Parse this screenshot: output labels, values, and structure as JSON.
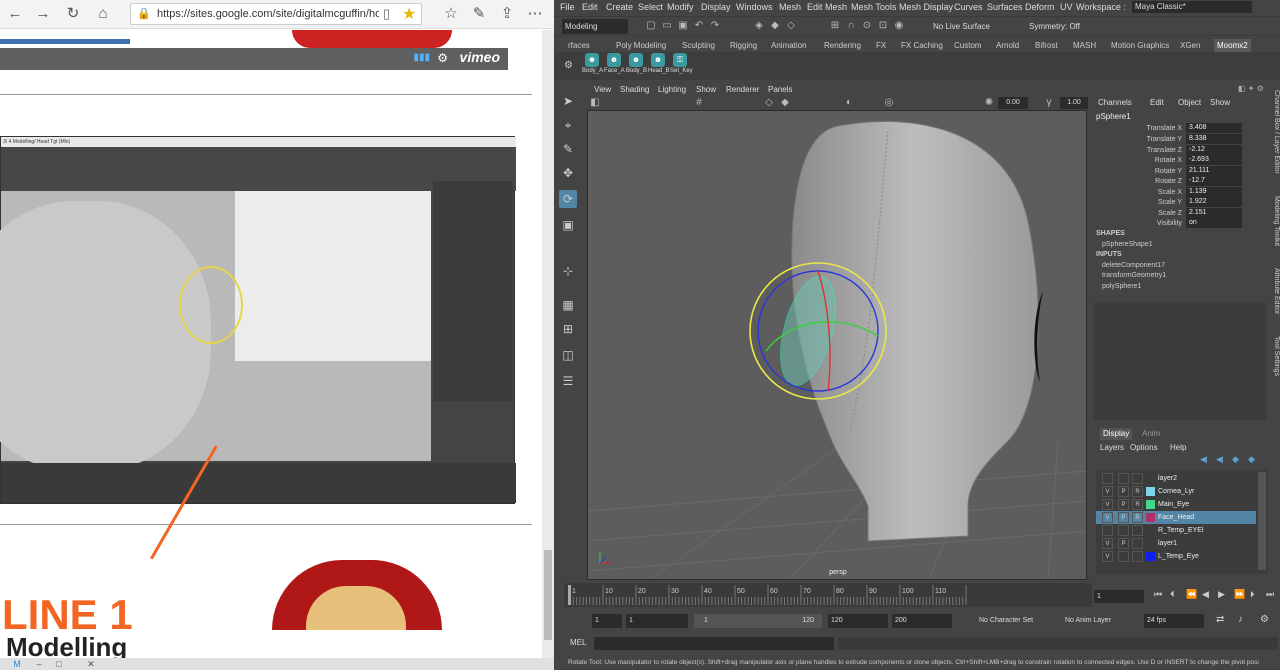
{
  "browser": {
    "url": "https://sites.google.com/site/digitalmcguffin/home/pipeli",
    "vimeo": "vimeo",
    "embed_title": "3/ 4 Modelling/ Head Tgt (Mlo)",
    "line1": "LINE 1",
    "modelling": "Modelling"
  },
  "maya": {
    "menus": [
      "File",
      "Edit",
      "Create",
      "Select",
      "Modify",
      "Display",
      "Windows",
      "Mesh",
      "Edit Mesh",
      "Mesh Tools",
      "Mesh Display",
      "Curves",
      "Surfaces",
      "Deform",
      "UV"
    ],
    "workspace_label": "Workspace :",
    "workspace_value": "Maya Classic*",
    "mode": "Modeling",
    "live_surface": "No Live Surface",
    "symmetry": "Symmetry: Off",
    "shelf_tabs": [
      "rfaces",
      "Poly Modeling",
      "Sculpting",
      "Rigging",
      "Animation",
      "Rendering",
      "FX",
      "FX Caching",
      "Custom",
      "Arnold",
      "Bifrost",
      "MASH",
      "Motion Graphics",
      "XGen",
      "Moomx2"
    ],
    "shelf_buttons": [
      "Body_A",
      "Face_A",
      "Body_B",
      "Head_B",
      "Set_Key"
    ],
    "panel_menus": [
      "View",
      "Shading",
      "Lighting",
      "Show",
      "Renderer",
      "Panels"
    ],
    "panel_num1": "0.00",
    "panel_num2": "1.00",
    "viewport_label": "persp",
    "channel_menus": [
      "Channels",
      "Edit",
      "Object",
      "Show"
    ],
    "object_name": "pSphere1",
    "channels": [
      {
        "k": "Translate X",
        "v": "3.408"
      },
      {
        "k": "Translate Y",
        "v": "8.338"
      },
      {
        "k": "Translate Z",
        "v": "-2.12"
      },
      {
        "k": "Rotate X",
        "v": "-2.693"
      },
      {
        "k": "Rotate Y",
        "v": "21.111"
      },
      {
        "k": "Rotate Z",
        "v": "-12.7"
      },
      {
        "k": "Scale X",
        "v": "1.139"
      },
      {
        "k": "Scale Y",
        "v": "1.922"
      },
      {
        "k": "Scale Z",
        "v": "2.151"
      },
      {
        "k": "Visibility",
        "v": "on"
      }
    ],
    "shapes_label": "SHAPES",
    "shape_name": "pSphereShape1",
    "inputs_label": "INPUTS",
    "inputs": [
      "deleteComponent17",
      "transformGeometry1",
      "polySphere1"
    ],
    "side_tabs": [
      "Channel Box / Layer Editor",
      "Modeling Toolkit",
      "Attribute Editor",
      "Tool Settings"
    ],
    "layer_tabs": [
      "Display",
      "Anim"
    ],
    "layer_menus": [
      "Layers",
      "Options",
      "Help"
    ],
    "layers": [
      {
        "v": "",
        "p": "",
        "r": "",
        "name": "layer2",
        "color": ""
      },
      {
        "v": "V",
        "p": "P",
        "r": "R",
        "name": "Cornea_Lyr",
        "color": "#7fd6ea"
      },
      {
        "v": "V",
        "p": "P",
        "r": "R",
        "name": "Main_Eye",
        "color": "#3fd98a"
      },
      {
        "v": "V",
        "p": "P",
        "r": "R",
        "name": "Face_Head",
        "color": "#b0306a"
      },
      {
        "v": "",
        "p": "",
        "r": "",
        "name": "R_Temp_EYEl",
        "color": ""
      },
      {
        "v": "V",
        "p": "P",
        "r": "",
        "name": "layer1",
        "color": ""
      },
      {
        "v": "V",
        "p": "",
        "r": "",
        "name": "L_Temp_Eye",
        "color": "#1020ee"
      }
    ],
    "timeline_ticks": [
      "1",
      "10",
      "20",
      "30",
      "40",
      "50",
      "60",
      "70",
      "80",
      "90",
      "100",
      "110"
    ],
    "current_frame": "1",
    "range": {
      "start": "1",
      "start2": "1",
      "slider_left": "1",
      "slider_right": "120",
      "end": "120",
      "end2": "200"
    },
    "no_char_set": "No Character Set",
    "no_anim_layer": "No Anim Layer",
    "fps": "24 fps",
    "mel_label": "MEL",
    "help_line": "Rotate Tool: Use manipulator to rotate object(s). Shift+drag manipulator axis or plane handles to extrude components or clone objects. Ctrl+Shift+LMB+drag to constrain rotation to connected edges. Use D or INSERT to change the pivot posi"
  }
}
